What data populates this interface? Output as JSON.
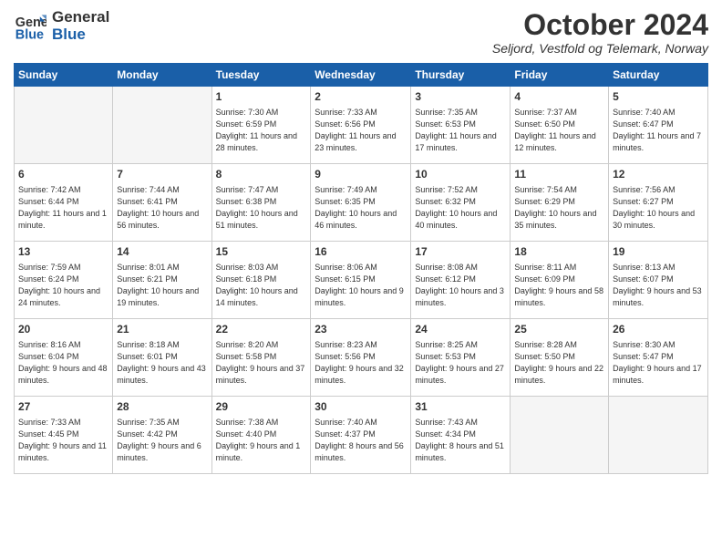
{
  "header": {
    "logo_line1": "General",
    "logo_line2": "Blue",
    "main_title": "October 2024",
    "subtitle": "Seljord, Vestfold og Telemark, Norway"
  },
  "weekdays": [
    "Sunday",
    "Monday",
    "Tuesday",
    "Wednesday",
    "Thursday",
    "Friday",
    "Saturday"
  ],
  "weeks": [
    [
      {
        "day": "",
        "info": ""
      },
      {
        "day": "",
        "info": ""
      },
      {
        "day": "1",
        "info": "Sunrise: 7:30 AM\nSunset: 6:59 PM\nDaylight: 11 hours and 28 minutes."
      },
      {
        "day": "2",
        "info": "Sunrise: 7:33 AM\nSunset: 6:56 PM\nDaylight: 11 hours and 23 minutes."
      },
      {
        "day": "3",
        "info": "Sunrise: 7:35 AM\nSunset: 6:53 PM\nDaylight: 11 hours and 17 minutes."
      },
      {
        "day": "4",
        "info": "Sunrise: 7:37 AM\nSunset: 6:50 PM\nDaylight: 11 hours and 12 minutes."
      },
      {
        "day": "5",
        "info": "Sunrise: 7:40 AM\nSunset: 6:47 PM\nDaylight: 11 hours and 7 minutes."
      }
    ],
    [
      {
        "day": "6",
        "info": "Sunrise: 7:42 AM\nSunset: 6:44 PM\nDaylight: 11 hours and 1 minute."
      },
      {
        "day": "7",
        "info": "Sunrise: 7:44 AM\nSunset: 6:41 PM\nDaylight: 10 hours and 56 minutes."
      },
      {
        "day": "8",
        "info": "Sunrise: 7:47 AM\nSunset: 6:38 PM\nDaylight: 10 hours and 51 minutes."
      },
      {
        "day": "9",
        "info": "Sunrise: 7:49 AM\nSunset: 6:35 PM\nDaylight: 10 hours and 46 minutes."
      },
      {
        "day": "10",
        "info": "Sunrise: 7:52 AM\nSunset: 6:32 PM\nDaylight: 10 hours and 40 minutes."
      },
      {
        "day": "11",
        "info": "Sunrise: 7:54 AM\nSunset: 6:29 PM\nDaylight: 10 hours and 35 minutes."
      },
      {
        "day": "12",
        "info": "Sunrise: 7:56 AM\nSunset: 6:27 PM\nDaylight: 10 hours and 30 minutes."
      }
    ],
    [
      {
        "day": "13",
        "info": "Sunrise: 7:59 AM\nSunset: 6:24 PM\nDaylight: 10 hours and 24 minutes."
      },
      {
        "day": "14",
        "info": "Sunrise: 8:01 AM\nSunset: 6:21 PM\nDaylight: 10 hours and 19 minutes."
      },
      {
        "day": "15",
        "info": "Sunrise: 8:03 AM\nSunset: 6:18 PM\nDaylight: 10 hours and 14 minutes."
      },
      {
        "day": "16",
        "info": "Sunrise: 8:06 AM\nSunset: 6:15 PM\nDaylight: 10 hours and 9 minutes."
      },
      {
        "day": "17",
        "info": "Sunrise: 8:08 AM\nSunset: 6:12 PM\nDaylight: 10 hours and 3 minutes."
      },
      {
        "day": "18",
        "info": "Sunrise: 8:11 AM\nSunset: 6:09 PM\nDaylight: 9 hours and 58 minutes."
      },
      {
        "day": "19",
        "info": "Sunrise: 8:13 AM\nSunset: 6:07 PM\nDaylight: 9 hours and 53 minutes."
      }
    ],
    [
      {
        "day": "20",
        "info": "Sunrise: 8:16 AM\nSunset: 6:04 PM\nDaylight: 9 hours and 48 minutes."
      },
      {
        "day": "21",
        "info": "Sunrise: 8:18 AM\nSunset: 6:01 PM\nDaylight: 9 hours and 43 minutes."
      },
      {
        "day": "22",
        "info": "Sunrise: 8:20 AM\nSunset: 5:58 PM\nDaylight: 9 hours and 37 minutes."
      },
      {
        "day": "23",
        "info": "Sunrise: 8:23 AM\nSunset: 5:56 PM\nDaylight: 9 hours and 32 minutes."
      },
      {
        "day": "24",
        "info": "Sunrise: 8:25 AM\nSunset: 5:53 PM\nDaylight: 9 hours and 27 minutes."
      },
      {
        "day": "25",
        "info": "Sunrise: 8:28 AM\nSunset: 5:50 PM\nDaylight: 9 hours and 22 minutes."
      },
      {
        "day": "26",
        "info": "Sunrise: 8:30 AM\nSunset: 5:47 PM\nDaylight: 9 hours and 17 minutes."
      }
    ],
    [
      {
        "day": "27",
        "info": "Sunrise: 7:33 AM\nSunset: 4:45 PM\nDaylight: 9 hours and 11 minutes."
      },
      {
        "day": "28",
        "info": "Sunrise: 7:35 AM\nSunset: 4:42 PM\nDaylight: 9 hours and 6 minutes."
      },
      {
        "day": "29",
        "info": "Sunrise: 7:38 AM\nSunset: 4:40 PM\nDaylight: 9 hours and 1 minute."
      },
      {
        "day": "30",
        "info": "Sunrise: 7:40 AM\nSunset: 4:37 PM\nDaylight: 8 hours and 56 minutes."
      },
      {
        "day": "31",
        "info": "Sunrise: 7:43 AM\nSunset: 4:34 PM\nDaylight: 8 hours and 51 minutes."
      },
      {
        "day": "",
        "info": ""
      },
      {
        "day": "",
        "info": ""
      }
    ]
  ]
}
